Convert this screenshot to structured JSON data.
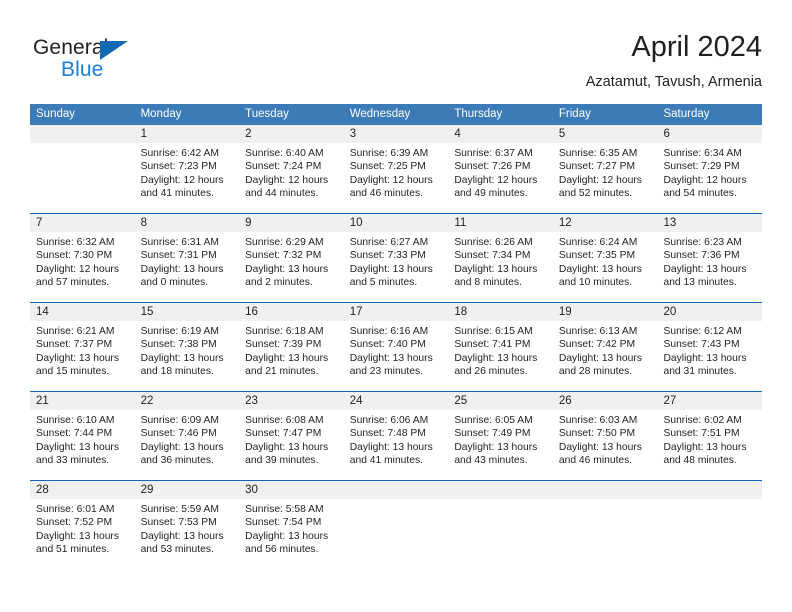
{
  "brand": {
    "name_part1": "General",
    "name_part2": "Blue",
    "triangle_color": "#1268b3",
    "blue_text_color": "#1c7fd4"
  },
  "header": {
    "title": "April 2024",
    "subtitle": "Azatamut, Tavush, Armenia"
  },
  "theme": {
    "header_row_bg": "#3b7cb8",
    "week_separator": "#1268b3",
    "daynum_band_bg": "#f0f0f0",
    "text": "#231f20"
  },
  "weekdays": [
    "Sunday",
    "Monday",
    "Tuesday",
    "Wednesday",
    "Thursday",
    "Friday",
    "Saturday"
  ],
  "weeks": [
    {
      "days": [
        {
          "num": "",
          "lines": []
        },
        {
          "num": "1",
          "lines": [
            "Sunrise: 6:42 AM",
            "Sunset: 7:23 PM",
            "Daylight: 12 hours",
            "and 41 minutes."
          ]
        },
        {
          "num": "2",
          "lines": [
            "Sunrise: 6:40 AM",
            "Sunset: 7:24 PM",
            "Daylight: 12 hours",
            "and 44 minutes."
          ]
        },
        {
          "num": "3",
          "lines": [
            "Sunrise: 6:39 AM",
            "Sunset: 7:25 PM",
            "Daylight: 12 hours",
            "and 46 minutes."
          ]
        },
        {
          "num": "4",
          "lines": [
            "Sunrise: 6:37 AM",
            "Sunset: 7:26 PM",
            "Daylight: 12 hours",
            "and 49 minutes."
          ]
        },
        {
          "num": "5",
          "lines": [
            "Sunrise: 6:35 AM",
            "Sunset: 7:27 PM",
            "Daylight: 12 hours",
            "and 52 minutes."
          ]
        },
        {
          "num": "6",
          "lines": [
            "Sunrise: 6:34 AM",
            "Sunset: 7:29 PM",
            "Daylight: 12 hours",
            "and 54 minutes."
          ]
        }
      ]
    },
    {
      "days": [
        {
          "num": "7",
          "lines": [
            "Sunrise: 6:32 AM",
            "Sunset: 7:30 PM",
            "Daylight: 12 hours",
            "and 57 minutes."
          ]
        },
        {
          "num": "8",
          "lines": [
            "Sunrise: 6:31 AM",
            "Sunset: 7:31 PM",
            "Daylight: 13 hours",
            "and 0 minutes."
          ]
        },
        {
          "num": "9",
          "lines": [
            "Sunrise: 6:29 AM",
            "Sunset: 7:32 PM",
            "Daylight: 13 hours",
            "and 2 minutes."
          ]
        },
        {
          "num": "10",
          "lines": [
            "Sunrise: 6:27 AM",
            "Sunset: 7:33 PM",
            "Daylight: 13 hours",
            "and 5 minutes."
          ]
        },
        {
          "num": "11",
          "lines": [
            "Sunrise: 6:26 AM",
            "Sunset: 7:34 PM",
            "Daylight: 13 hours",
            "and 8 minutes."
          ]
        },
        {
          "num": "12",
          "lines": [
            "Sunrise: 6:24 AM",
            "Sunset: 7:35 PM",
            "Daylight: 13 hours",
            "and 10 minutes."
          ]
        },
        {
          "num": "13",
          "lines": [
            "Sunrise: 6:23 AM",
            "Sunset: 7:36 PM",
            "Daylight: 13 hours",
            "and 13 minutes."
          ]
        }
      ]
    },
    {
      "days": [
        {
          "num": "14",
          "lines": [
            "Sunrise: 6:21 AM",
            "Sunset: 7:37 PM",
            "Daylight: 13 hours",
            "and 15 minutes."
          ]
        },
        {
          "num": "15",
          "lines": [
            "Sunrise: 6:19 AM",
            "Sunset: 7:38 PM",
            "Daylight: 13 hours",
            "and 18 minutes."
          ]
        },
        {
          "num": "16",
          "lines": [
            "Sunrise: 6:18 AM",
            "Sunset: 7:39 PM",
            "Daylight: 13 hours",
            "and 21 minutes."
          ]
        },
        {
          "num": "17",
          "lines": [
            "Sunrise: 6:16 AM",
            "Sunset: 7:40 PM",
            "Daylight: 13 hours",
            "and 23 minutes."
          ]
        },
        {
          "num": "18",
          "lines": [
            "Sunrise: 6:15 AM",
            "Sunset: 7:41 PM",
            "Daylight: 13 hours",
            "and 26 minutes."
          ]
        },
        {
          "num": "19",
          "lines": [
            "Sunrise: 6:13 AM",
            "Sunset: 7:42 PM",
            "Daylight: 13 hours",
            "and 28 minutes."
          ]
        },
        {
          "num": "20",
          "lines": [
            "Sunrise: 6:12 AM",
            "Sunset: 7:43 PM",
            "Daylight: 13 hours",
            "and 31 minutes."
          ]
        }
      ]
    },
    {
      "days": [
        {
          "num": "21",
          "lines": [
            "Sunrise: 6:10 AM",
            "Sunset: 7:44 PM",
            "Daylight: 13 hours",
            "and 33 minutes."
          ]
        },
        {
          "num": "22",
          "lines": [
            "Sunrise: 6:09 AM",
            "Sunset: 7:46 PM",
            "Daylight: 13 hours",
            "and 36 minutes."
          ]
        },
        {
          "num": "23",
          "lines": [
            "Sunrise: 6:08 AM",
            "Sunset: 7:47 PM",
            "Daylight: 13 hours",
            "and 39 minutes."
          ]
        },
        {
          "num": "24",
          "lines": [
            "Sunrise: 6:06 AM",
            "Sunset: 7:48 PM",
            "Daylight: 13 hours",
            "and 41 minutes."
          ]
        },
        {
          "num": "25",
          "lines": [
            "Sunrise: 6:05 AM",
            "Sunset: 7:49 PM",
            "Daylight: 13 hours",
            "and 43 minutes."
          ]
        },
        {
          "num": "26",
          "lines": [
            "Sunrise: 6:03 AM",
            "Sunset: 7:50 PM",
            "Daylight: 13 hours",
            "and 46 minutes."
          ]
        },
        {
          "num": "27",
          "lines": [
            "Sunrise: 6:02 AM",
            "Sunset: 7:51 PM",
            "Daylight: 13 hours",
            "and 48 minutes."
          ]
        }
      ]
    },
    {
      "days": [
        {
          "num": "28",
          "lines": [
            "Sunrise: 6:01 AM",
            "Sunset: 7:52 PM",
            "Daylight: 13 hours",
            "and 51 minutes."
          ]
        },
        {
          "num": "29",
          "lines": [
            "Sunrise: 5:59 AM",
            "Sunset: 7:53 PM",
            "Daylight: 13 hours",
            "and 53 minutes."
          ]
        },
        {
          "num": "30",
          "lines": [
            "Sunrise: 5:58 AM",
            "Sunset: 7:54 PM",
            "Daylight: 13 hours",
            "and 56 minutes."
          ]
        },
        {
          "num": "",
          "lines": []
        },
        {
          "num": "",
          "lines": []
        },
        {
          "num": "",
          "lines": []
        },
        {
          "num": "",
          "lines": []
        }
      ]
    }
  ]
}
